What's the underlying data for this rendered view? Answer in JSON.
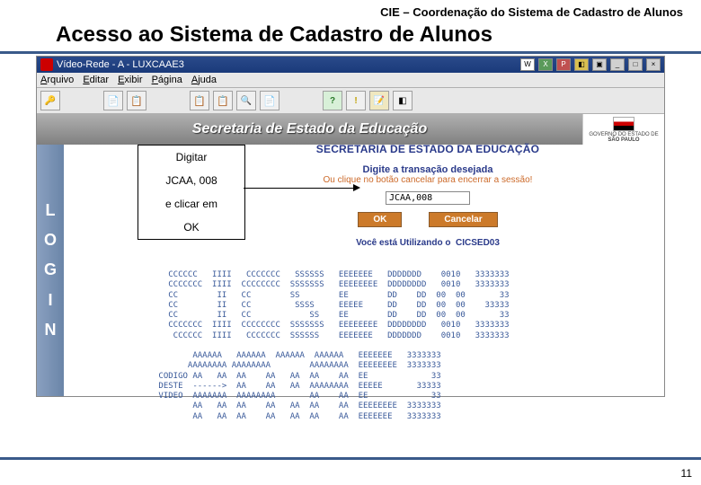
{
  "header": {
    "org": "CIE – Coordenação do Sistema de Cadastro de Alunos",
    "title": "Acesso ao Sistema de Cadastro de Alunos"
  },
  "window": {
    "title": "Vídeo-Rede - A - LUXCAAE3",
    "menu": {
      "arquivo": "Arquivo",
      "editar": "Editar",
      "exibir": "Exibir",
      "pagina": "Página",
      "ajuda": "Ajuda"
    },
    "banner": "Secretaria de Estado da Educação",
    "gov_line1": "GOVERNO DO ESTADO DE",
    "gov_line2": "SÃO PAULO"
  },
  "callout": {
    "l1": "Digitar",
    "l2": "JCAA, 008",
    "l3": "e clicar em",
    "l4": "OK"
  },
  "dialog": {
    "heading": "SECRETARIA DE ESTADO DA EDUCAÇÃO",
    "prompt1": "Digite a transação desejada",
    "prompt2": "Ou clique no botão cancelar para encerrar a sessão!",
    "value": "JCAA,008",
    "ok": "OK",
    "cancel": "Cancelar",
    "status_prefix": "Você está Utilizando o",
    "status_host": "CICSED03"
  },
  "login_letters": [
    "L",
    "O",
    "G",
    "I",
    "N"
  ],
  "ascii": "   CCCCCC   IIII   CCCCCCC   SSSSSS   EEEEEEE   DDDDDDD    0010   3333333\n   CCCCCCC  IIII  CCCCCCCC  SSSSSSS   EEEEEEEE  DDDDDDDD   0010   3333333\n   CC        II   CC        SS        EE        DD    DD  00  00       33\n   CC        II   CC         SSSS     EEEEE     DD    DD  00  00    33333\n   CC        II   CC            SS    EE        DD    DD  00  00       33\n   CCCCCCC  IIII  CCCCCCCC  SSSSSSS   EEEEEEEE  DDDDDDDD   0010   3333333\n    CCCCCC  IIII   CCCCCCC  SSSSSS    EEEEEEE   DDDDDDD    0010   3333333\n\n        AAAAAA   AAAAAA  AAAAAA  AAAAAA   EEEEEEE   3333333\n       AAAAAAAA AAAAAAAA        AAAAAAAA  EEEEEEEE  3333333\n CODIGO AA   AA  AA    AA   AA  AA    AA  EE             33\n DESTE  ------>  AA    AA   AA  AAAAAAAA  EEEEE       33333\n VIDEO  AAAAAAA  AAAAAAAA       AA    AA  EE             33\n        AA   AA  AA    AA   AA  AA    AA  EEEEEEEE  3333333\n        AA   AA  AA    AA   AA  AA    AA  EEEEEEE   3333333",
  "slide_number": "11"
}
